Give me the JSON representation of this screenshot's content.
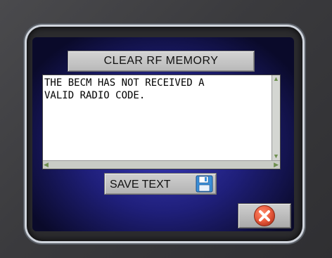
{
  "dialog": {
    "title_button_label": "CLEAR RF MEMORY",
    "message_lines": [
      "THE BECM HAS NOT RECEIVED A",
      "VALID RADIO CODE."
    ],
    "save_button_label": "SAVE TEXT"
  },
  "icons": {
    "save": "floppy-disk-icon",
    "close": "close-icon",
    "scroll_up": "triangle-up",
    "scroll_down": "triangle-down",
    "scroll_left": "triangle-left",
    "scroll_right": "triangle-right"
  },
  "colors": {
    "screen_blue": "#2a2a9e",
    "close_red": "#e85a3c",
    "scroll_arrow": "#6e8f4e"
  }
}
